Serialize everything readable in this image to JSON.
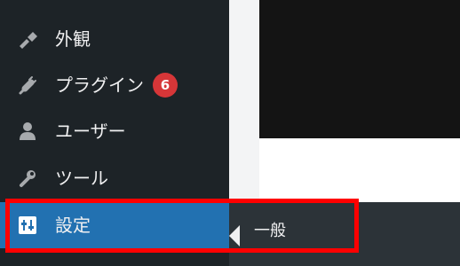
{
  "sidebar": {
    "items": [
      {
        "label": "外観",
        "icon": "brush-icon"
      },
      {
        "label": "プラグイン",
        "icon": "plugin-icon",
        "badge": "6"
      },
      {
        "label": "ユーザー",
        "icon": "user-icon"
      },
      {
        "label": "ツール",
        "icon": "wrench-icon"
      },
      {
        "label": "設定",
        "icon": "settings-icon",
        "active": true
      }
    ]
  },
  "submenu": {
    "items": [
      {
        "label": "一般"
      }
    ]
  },
  "colors": {
    "sidebar_bg": "#1d2327",
    "text": "#f0f0f1",
    "badge": "#d63638",
    "accent": "#2271b1",
    "highlight": "#ff0000"
  }
}
